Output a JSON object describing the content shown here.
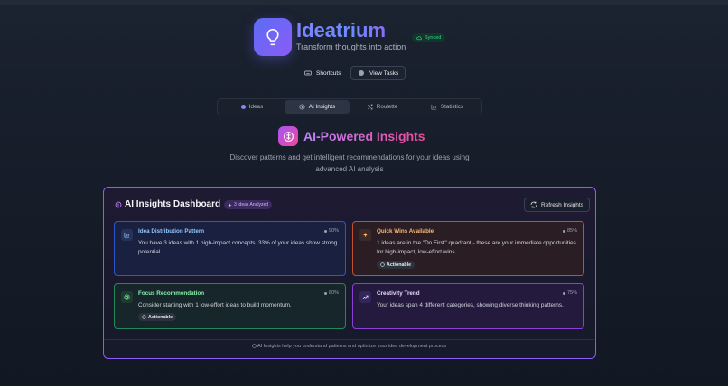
{
  "header": {
    "brand": "Ideatrium",
    "tagline": "Transform thoughts into action",
    "status": "Synced",
    "shortcuts_label": "Shortcuts",
    "view_tasks_label": "View Tasks"
  },
  "tabs": [
    {
      "label": "Ideas",
      "icon": "dot-icon"
    },
    {
      "label": "AI Insights",
      "icon": "brain-icon",
      "active": true
    },
    {
      "label": "Roulette",
      "icon": "shuffle-icon"
    },
    {
      "label": "Statistics",
      "icon": "bar-chart-icon"
    }
  ],
  "section": {
    "title": "AI-Powered Insights",
    "description": "Discover patterns and get intelligent recommendations for your ideas using advanced AI analysis"
  },
  "dashboard": {
    "title": "AI Insights Dashboard",
    "analyzed_badge": "3 Ideas Analyzed",
    "refresh_label": "Refresh Insights",
    "footnote": "AI Insights help you understand patterns and optimize your idea development process",
    "cards": [
      {
        "title": "Idea Distribution Pattern",
        "confidence": "90%",
        "text": "You have 3 ideas with 1 high-impact concepts. 33% of your ideas show strong potential.",
        "badge": ""
      },
      {
        "title": "Quick Wins Available",
        "confidence": "85%",
        "text": "1 ideas are in the \"Do First\" quadrant - these are your immediate opportunities for high-impact, low-effort wins.",
        "badge": "Actionable"
      },
      {
        "title": "Focus Recommendation",
        "confidence": "80%",
        "text": "Consider starting with 1 low-effort ideas to build momentum.",
        "badge": "Actionable"
      },
      {
        "title": "Creativity Trend",
        "confidence": "75%",
        "text": "Your ideas span 4 different categories, showing diverse thinking patterns.",
        "badge": ""
      }
    ]
  },
  "colors": {
    "accent": "#8b5cf6",
    "pink": "#ec4899",
    "success": "#34d399"
  }
}
